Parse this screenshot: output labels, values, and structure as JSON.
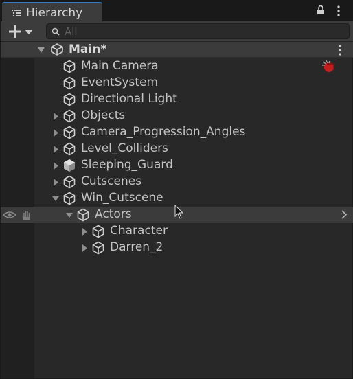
{
  "window": {
    "tab_title": "Hierarchy",
    "tab_icon": "hierarchy-list-icon",
    "lock_icon": "lock-icon",
    "menu_icon": "kebab-menu-icon"
  },
  "toolbar": {
    "add_icon": "plus-icon",
    "dropdown_icon": "dropdown-caret-icon",
    "search_icon": "search-icon",
    "search_placeholder": "All",
    "search_value": ""
  },
  "scene": {
    "name": "Main*",
    "icon": "unity-scene-icon",
    "expanded": true
  },
  "items": [
    {
      "label": "Main Camera",
      "has_children": false,
      "expanded": false,
      "depth": 1
    },
    {
      "label": "EventSystem",
      "has_children": false,
      "expanded": false,
      "depth": 1
    },
    {
      "label": "Directional Light",
      "has_children": false,
      "expanded": false,
      "depth": 1
    },
    {
      "label": "Objects",
      "has_children": true,
      "expanded": false,
      "depth": 1
    },
    {
      "label": "Camera_Progression_Angles",
      "has_children": true,
      "expanded": false,
      "depth": 1
    },
    {
      "label": "Level_Colliders",
      "has_children": true,
      "expanded": false,
      "depth": 1
    },
    {
      "label": "Sleeping_Guard",
      "has_children": true,
      "expanded": false,
      "depth": 1,
      "prefab": true
    },
    {
      "label": "Cutscenes",
      "has_children": true,
      "expanded": false,
      "depth": 1
    },
    {
      "label": "Win_Cutscene",
      "has_children": true,
      "expanded": true,
      "depth": 1
    },
    {
      "label": "Actors",
      "has_children": true,
      "expanded": true,
      "depth": 2,
      "selected": true
    },
    {
      "label": "Character",
      "has_children": true,
      "expanded": false,
      "depth": 3
    },
    {
      "label": "Darren_2",
      "has_children": true,
      "expanded": false,
      "depth": 3
    }
  ],
  "colors": {
    "panel_bg": "#282828",
    "toolbar_bg": "#3c3c3c",
    "scene_header_bg": "#3b3b3b",
    "text": "#c4c4c4",
    "tab_accent": "#3a79bb",
    "gizmo_red": "#c41e1e"
  }
}
